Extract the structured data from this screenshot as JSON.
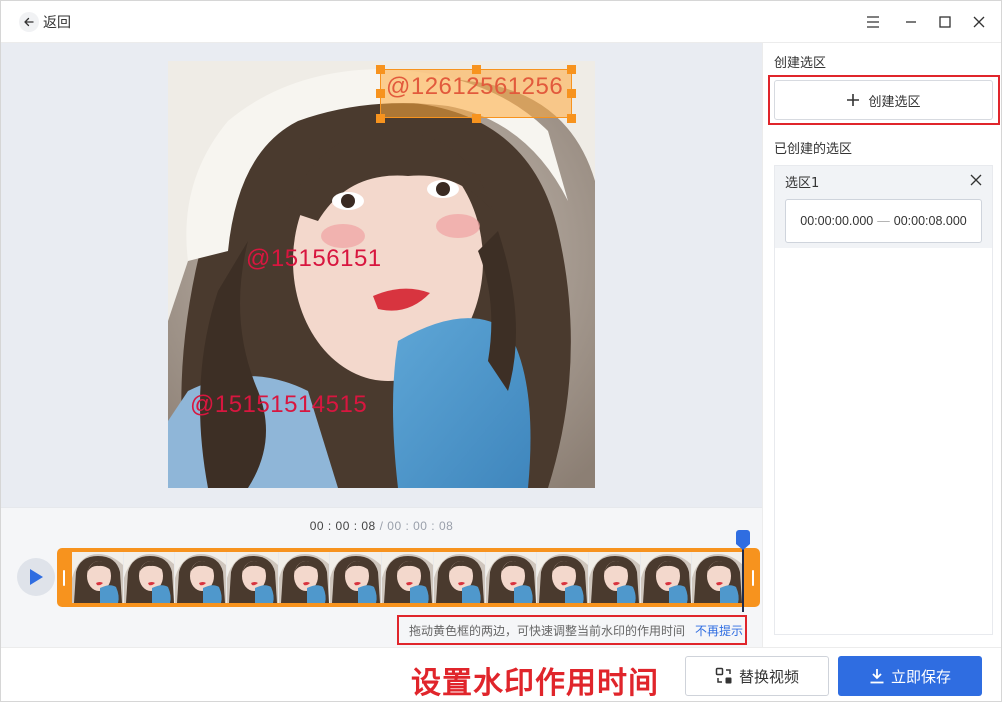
{
  "titlebar": {
    "back_label": "返回"
  },
  "preview": {
    "watermarks": [
      {
        "text": "@12612561256",
        "color": "#e25a3c"
      },
      {
        "text": "@15156151",
        "color": "#d8163f"
      },
      {
        "text": "@15151514515",
        "color": "#d8163f"
      }
    ]
  },
  "timeline": {
    "current_time": "00 : 00 : 08",
    "separator": "/",
    "total_time": "00 : 00 : 08",
    "frame_count": 13,
    "hint_text": "拖动黄色框的两边，可快速调整当前水印的作用时间",
    "hint_link": "不再提示"
  },
  "right_panel": {
    "create_section_title": "创建选区",
    "create_button_label": "创建选区",
    "created_section_title": "已创建的选区",
    "selections": [
      {
        "name": "选区1",
        "start": "00:00:00.000",
        "end": "00:00:08.000"
      }
    ]
  },
  "bottom": {
    "annotation": "设置水印作用时间",
    "replace_label": "替换视频",
    "save_label": "立即保存"
  },
  "colors": {
    "accent": "#2f6de1",
    "selection_orange": "#f7931e",
    "annotation_red": "#e0252b"
  }
}
